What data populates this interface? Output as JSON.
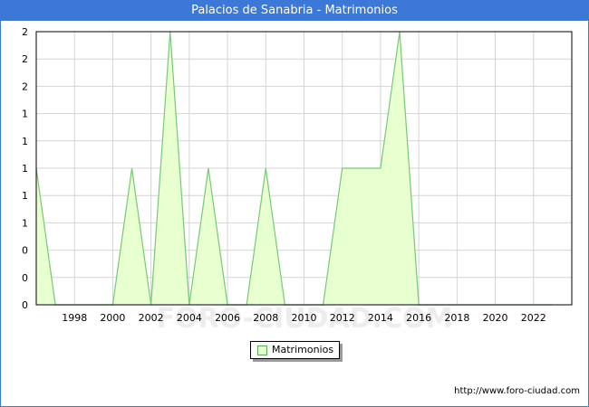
{
  "window": {
    "title": "Palacios de Sanabria - Matrimonios"
  },
  "footer": {
    "url": "http://www.foro-ciudad.com"
  },
  "watermark": "FORO-CIUDAD.COM",
  "colors": {
    "title_bar": "#3b78d8",
    "area_fill": "#e8ffd0",
    "area_line": "#78c878",
    "grid": "#d4d4d4"
  },
  "chart_data": {
    "type": "area",
    "title": "Palacios de Sanabria - Matrimonios",
    "xlabel": "",
    "ylabel": "",
    "x_ticks": [
      "1998",
      "2000",
      "2002",
      "2004",
      "2006",
      "2008",
      "2010",
      "2012",
      "2014",
      "2016",
      "2018",
      "2020",
      "2022"
    ],
    "y_ticks": [
      "0",
      "0",
      "0",
      "1",
      "1",
      "1",
      "1",
      "1",
      "2",
      "2",
      "2"
    ],
    "xlim": [
      1996,
      2024
    ],
    "ylim": [
      0,
      2
    ],
    "grid": true,
    "legend_position": "bottom-center",
    "series": [
      {
        "name": "Matrimonios",
        "x": [
          1996,
          1997,
          1998,
          1999,
          2000,
          2001,
          2002,
          2003,
          2004,
          2005,
          2006,
          2007,
          2008,
          2009,
          2010,
          2011,
          2012,
          2013,
          2014,
          2015,
          2016,
          2017,
          2018,
          2019,
          2020,
          2021,
          2022,
          2023
        ],
        "values": [
          1,
          0,
          0,
          0,
          0,
          1,
          0,
          2,
          0,
          1,
          0,
          0,
          1,
          0,
          0,
          0,
          1,
          1,
          1,
          2,
          0,
          0,
          0,
          0,
          0,
          0,
          0,
          0
        ]
      }
    ]
  }
}
